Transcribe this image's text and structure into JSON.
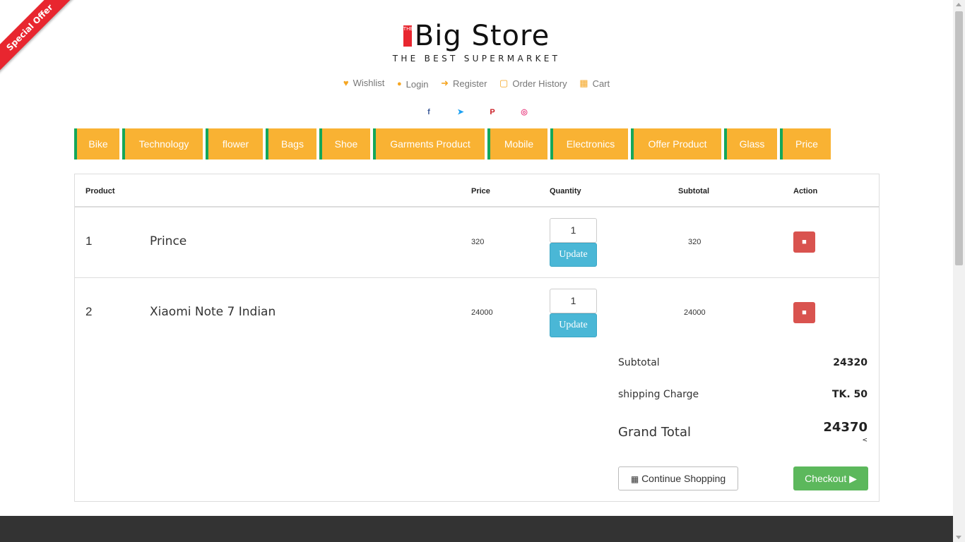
{
  "ribbon": {
    "text": "Special Offer"
  },
  "logo": {
    "badge": "THE",
    "title": "Big Store",
    "tagline": "THE BEST SUPERMARKET"
  },
  "toplinks": [
    {
      "label": "Wishlist",
      "icon": "heart-icon",
      "glyph": "♥"
    },
    {
      "label": "Login",
      "icon": "user-icon",
      "glyph": "👤"
    },
    {
      "label": "Register",
      "icon": "arrow-right-icon",
      "glyph": "➜"
    },
    {
      "label": "Order History",
      "icon": "file-icon",
      "glyph": "🗎"
    },
    {
      "label": "Cart",
      "icon": "cart-icon",
      "glyph": "🛒"
    }
  ],
  "social": [
    {
      "glyph": "f",
      "name": "facebook-icon",
      "color": "#3b5998"
    },
    {
      "glyph": "🐦",
      "name": "twitter-icon",
      "color": "#1da1f2"
    },
    {
      "glyph": "P",
      "name": "pinterest-icon",
      "color": "#cb2027"
    },
    {
      "glyph": "◎",
      "name": "dribbble-icon",
      "color": "#ea4c89"
    }
  ],
  "categories": [
    "Bike",
    "Technology",
    "flower",
    "Bags",
    "Shoe",
    "Garments Product",
    "Mobile",
    "Electronics",
    "Offer Product",
    "Glass",
    "Price"
  ],
  "cart": {
    "headers": {
      "product": "Product",
      "price": "Price",
      "quantity": "Quantity",
      "subtotal": "Subtotal",
      "action": "Action"
    },
    "items": [
      {
        "index": "1",
        "name": "Prince",
        "price": "320",
        "qty": "1",
        "subtotal": "320",
        "update": "Update"
      },
      {
        "index": "2",
        "name": "Xiaomi Note 7 Indian",
        "price": "24000",
        "qty": "1",
        "subtotal": "24000",
        "update": "Update"
      }
    ],
    "summary": {
      "subtotal_label": "Subtotal",
      "subtotal_value": "24320",
      "shipping_label": "shipping Charge",
      "shipping_value": "TK. 50",
      "grand_label": "Grand Total",
      "grand_value": "24370",
      "grand_note": "<"
    },
    "continue_label": "Continue Shopping",
    "checkout_label": "Checkout"
  },
  "colors": {
    "accent": "#f9b233",
    "nav_border": "#14a75a",
    "update": "#4ab7d6",
    "delete": "#d9534f",
    "checkout": "#5cb85c",
    "footer": "#333333"
  }
}
